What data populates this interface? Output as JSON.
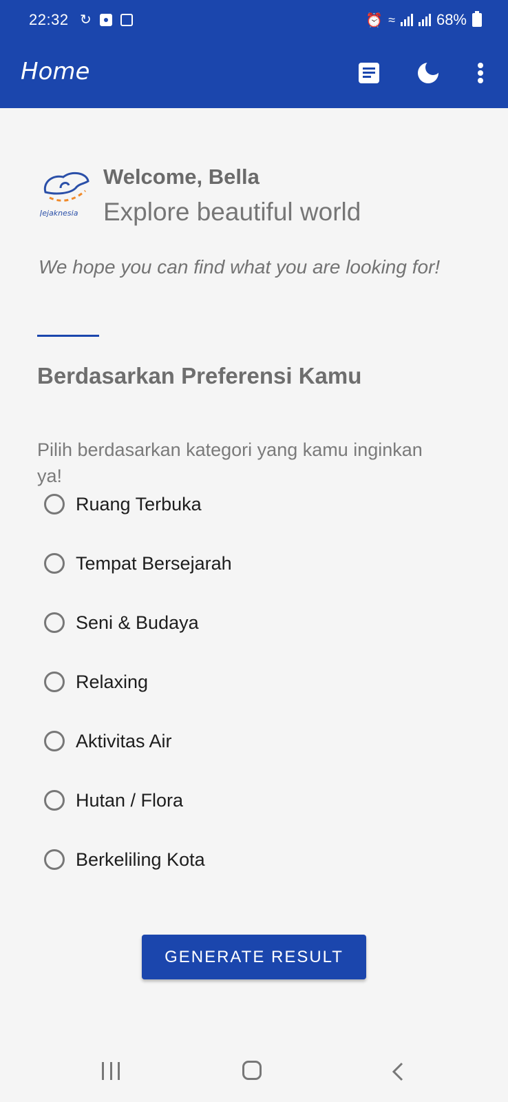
{
  "status_bar": {
    "time": "22:32",
    "battery": "68%"
  },
  "app_bar": {
    "title": "Home",
    "actions": [
      "document-icon",
      "moon-icon",
      "more-vert-icon"
    ],
    "color": "#1b46ad"
  },
  "header": {
    "logo_text": "Jejaknesia",
    "welcome": "Welcome, Bella",
    "subtitle": "Explore beautiful world",
    "hope": "We hope you can find what you are looking for!"
  },
  "section": {
    "title": "Berdasarkan Preferensi Kamu",
    "instruction": "Pilih berdasarkan kategori yang kamu inginkan ya!"
  },
  "categories": [
    {
      "label": "Ruang Terbuka",
      "selected": false
    },
    {
      "label": "Tempat Bersejarah",
      "selected": false
    },
    {
      "label": "Seni & Budaya",
      "selected": false
    },
    {
      "label": "Relaxing",
      "selected": false
    },
    {
      "label": "Aktivitas Air",
      "selected": false
    },
    {
      "label": "Hutan / Flora",
      "selected": false
    },
    {
      "label": "Berkeliling Kota",
      "selected": false
    }
  ],
  "button": {
    "label": "GENERATE RESULT"
  }
}
